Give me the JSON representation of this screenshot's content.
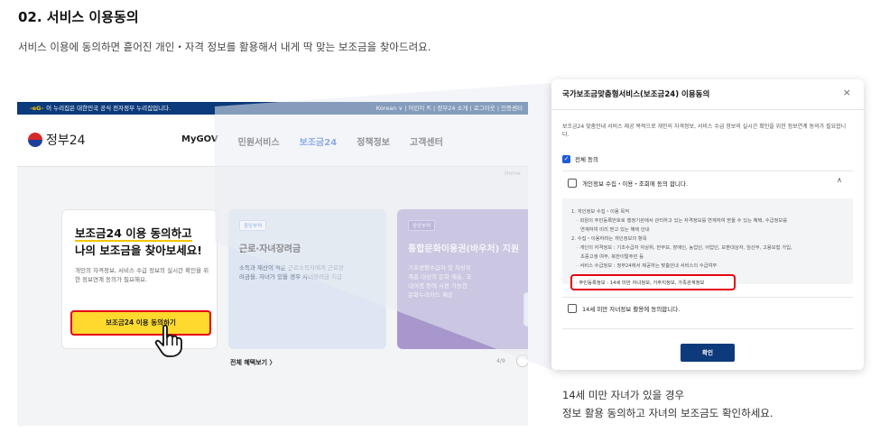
{
  "section": {
    "title": "02. 서비스 이용동의",
    "subtitle": "서비스 이용에 동의하면 흩어진 개인・자격 정보를 활용해서 내게 딱 맞는 보조금을 찾아드려요."
  },
  "screenshot": {
    "gov_bar": {
      "notice": "이 누리집은 대한민국 공식 전자정부 누리집입니다.",
      "links": "Korean ∨ | 어린이 ⇱ | 정부24 소개 | 로그아웃 | 인증센터"
    },
    "brand": "정부24",
    "menu": [
      "MyGOV",
      "민원서비스",
      "보조금24",
      "정책정보",
      "고객센터"
    ],
    "menu_active_index": 2,
    "breadcrumb": "Home",
    "main_card": {
      "heading_line1": "보조금24 이용 동의하고",
      "heading_line2": "나의 보조금을 찾아보세요!",
      "desc": "개인의 자격정보, 서비스 수급 정보의 실시간 확인을 위한 정보연계 동의가 필요해요.",
      "button": "보조금24 이용 동의하기"
    },
    "card2": {
      "tag": "중앙부처",
      "title": "근로·자녀장려금",
      "desc": "소득과 재산이 적은 근로소득자에게 근로장\n려금을, 자녀가 있을 경우 자녀장려금 지급"
    },
    "card3": {
      "tag": "중앙부처",
      "title": "통합문화이용권(바우처) 지원",
      "desc": "기초생활수급자 및 차상위\n계층 대상의 문화 예술, 국\n내여행 등에 사용 가능한\n문화누리카드 제공"
    },
    "all_benefits": "전체 혜택보기 〉",
    "pager": "4/9"
  },
  "modal": {
    "title": "국가보조금맞춤형서비스(보조금24) 이용동의",
    "close": "×",
    "desc": "보조금24 맞춤안내 서비스 제공 목적으로 개인의 자격정보, 서비스 수급 정보의 실시간 확인을 위한 정보연계 동의가 필요합니다.",
    "check_all": "전체 동의",
    "section1": "개인정보 수집・이용・조회에 동의 합니다.",
    "details": [
      "1. 개인정보 수집・이용 목적",
      "· 회원의 주민등록번호로 행정기관에서 관리하고 있는 자격정보를 연계하여 받을 수 있는 혜택, 수급정보를",
      "연계하여 미리 받고 있는 혜택 안내",
      "2. 수집・이용하려는 개인정보의 항목",
      "· 개인의 자격정보 : 기초수급자 자상위, 한부모, 장애인, 농업인, 어업인, 보훈대상자, 임산부, 고용보험 가입,",
      "초중고생 여부, 북한이탈주민 등",
      "· 서비스 수급정보 : 정부24에서 제공하는 맞춤안내 서비스의 수급여부"
    ],
    "highlight": "· 주민등록정보 : 14세 미만 자녀정보, 거주지정보, 가족관계정보",
    "section2": "14세 미만 자녀정보 활용에 동의합니다.",
    "confirm": "확인"
  },
  "caption": {
    "line1": "14세 미만 자녀가 있을 경우",
    "line2": "정보 활용 동의하고 자녀의 보조금도 확인하세요."
  },
  "colors": {
    "gov_blue": "#0c3a7a",
    "accent_blue": "#1e5bd8",
    "highlight_red": "#e60012",
    "cta_yellow": "#ffd92e"
  }
}
